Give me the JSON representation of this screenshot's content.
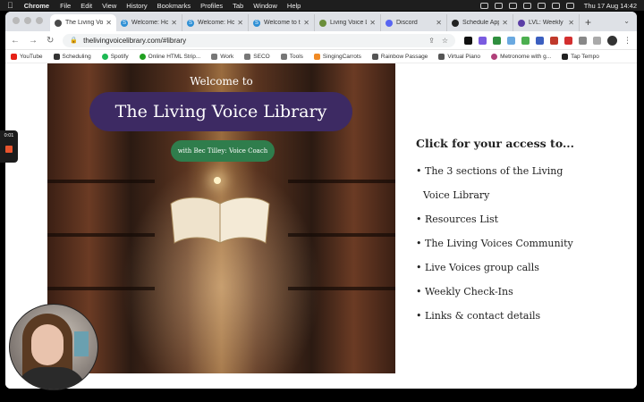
{
  "menubar": {
    "app": "Chrome",
    "items": [
      "File",
      "Edit",
      "View",
      "History",
      "Bookmarks",
      "Profiles",
      "Tab",
      "Window",
      "Help"
    ],
    "datetime": "Thu 17 Aug  14:42"
  },
  "tabs": [
    {
      "title": "The Living Voic",
      "color": "#4a4a4a",
      "active": true
    },
    {
      "title": "Welcome: How",
      "color": "#2d8fd5"
    },
    {
      "title": "Welcome: How",
      "color": "#2d8fd5"
    },
    {
      "title": "Welcome to the",
      "color": "#2d8fd5"
    },
    {
      "title": "Living Voice Lib",
      "color": "#6b8e3a"
    },
    {
      "title": "Discord",
      "color": "#5865f2"
    },
    {
      "title": "Schedule Appo",
      "color": "#222222"
    },
    {
      "title": "LVL: Weekly Ch",
      "color": "#5b3ea6"
    }
  ],
  "address": {
    "url": "thelivingvoicelibrary.com/#library"
  },
  "bookmarks": [
    {
      "label": "YouTube",
      "color": "#e62117"
    },
    {
      "label": "Scheduling",
      "color": "#333333"
    },
    {
      "label": "Spotify",
      "color": "#1db954"
    },
    {
      "label": "Online HTML Strip...",
      "color": "#20a020"
    },
    {
      "label": "Work",
      "color": "#777777"
    },
    {
      "label": "SECO",
      "color": "#777777"
    },
    {
      "label": "Tools",
      "color": "#777777"
    },
    {
      "label": "SingingCarrots",
      "color": "#f08a24"
    },
    {
      "label": "Rainbow Passage",
      "color": "#555555"
    },
    {
      "label": "Virtual Piano",
      "color": "#555555"
    },
    {
      "label": "Metronome with g...",
      "color": "#b0407a"
    },
    {
      "label": "Tap Tempo",
      "color": "#222222"
    }
  ],
  "hero": {
    "welcome": "Welcome to",
    "title": "The Living Voice Library",
    "subtitle": "with Bec Tilley: Voice Coach",
    "title_bg": "#3d2a63",
    "subtitle_bg": "#2f7d4c"
  },
  "panel": {
    "heading": "Click for your access to...",
    "items": [
      "• The 3 sections of the Living",
      "Voice Library",
      "• Resources List",
      "• The Living Voices Community",
      "• Live Voices group calls",
      "• Weekly Check-Ins",
      "• Links & contact details"
    ]
  },
  "recorder": {
    "time": "0:01"
  }
}
